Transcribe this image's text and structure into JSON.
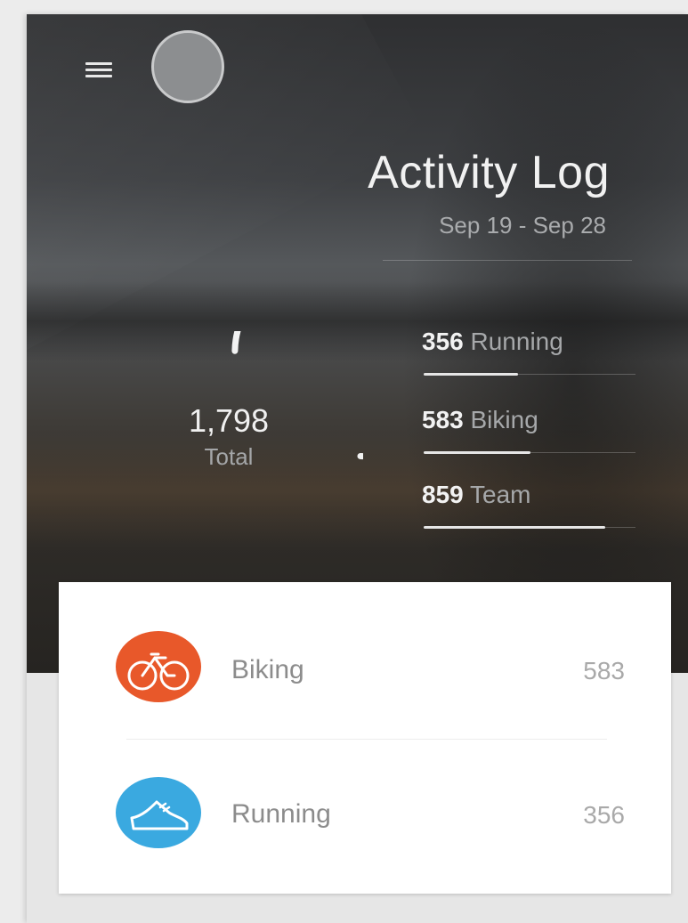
{
  "header": {
    "title": "Activity Log",
    "date_range": "Sep 19 - Sep 28"
  },
  "summary": {
    "total_value": "1,798",
    "total_label": "Total",
    "stats": [
      {
        "value": "356",
        "label": "Running",
        "fraction": 0.41
      },
      {
        "value": "583",
        "label": "Biking",
        "fraction": 0.5
      },
      {
        "value": "859",
        "label": "Team",
        "fraction": 0.86
      }
    ]
  },
  "activities": [
    {
      "name": "Biking",
      "count": "583",
      "icon": "bike-icon",
      "color": "#e8582a"
    },
    {
      "name": "Running",
      "count": "356",
      "icon": "running-shoe-icon",
      "color": "#3aa9e0"
    }
  ],
  "colors": {
    "ring": "#f2f2f2",
    "biking": "#e8582a",
    "running": "#3aa9e0"
  }
}
